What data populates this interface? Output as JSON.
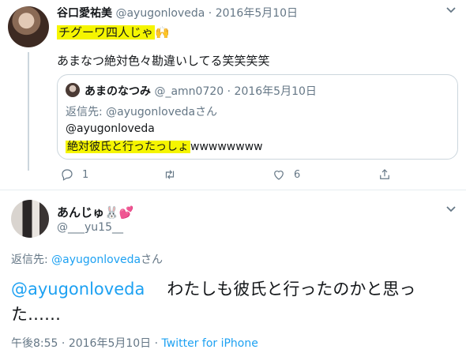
{
  "tweet1": {
    "name": "谷口愛祐美",
    "handle": "@ayugonloveda",
    "sep": "·",
    "date": "2016年5月10日",
    "line1_highlight": "チグーワ四人じゃ",
    "line1_emoji": "🙌",
    "line2": "あまなつ絶対色々勘違いしてる笑笑笑笑",
    "quote": {
      "name": "あまのなつみ",
      "handle": "@_amn0720",
      "sep": "·",
      "date": "2016年5月10日",
      "reply_prefix": "返信先: ",
      "reply_to": "@ayugonloveda",
      "reply_suffix": "さん",
      "line1": "@ayugonloveda",
      "line2_highlight": "絶対彼氏と行ったっしょ",
      "line2_rest": "wwwwwwww"
    },
    "actions": {
      "reply_count": "1",
      "retweet_count": "",
      "like_count": "6"
    }
  },
  "tweet2": {
    "name": "あんじゅ",
    "name_emoji": "🐰💕",
    "handle": "@___yu15__",
    "reply_prefix": "返信先: ",
    "reply_to": "@ayugonloveda",
    "reply_suffix": "さん",
    "mention": "@ayugonloveda",
    "body": "わたしも彼氏と行ったのかと思った……",
    "time": "午後8:55",
    "sep": "·",
    "date": "2016年5月10日",
    "sep2": "·",
    "source": "Twitter for iPhone"
  },
  "colors": {
    "highlight": "#f5f500",
    "link": "#1da1f2",
    "muted": "#657786"
  },
  "icons": [
    "chevron-down-icon",
    "reply-icon",
    "retweet-icon",
    "like-icon",
    "share-icon"
  ]
}
